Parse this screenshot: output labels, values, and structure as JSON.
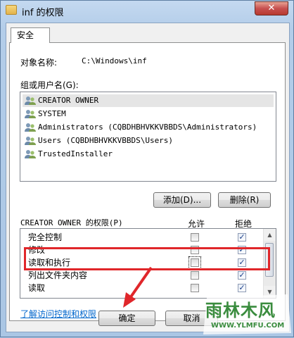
{
  "window": {
    "title": "inf 的权限",
    "close_label": "✕"
  },
  "tab": {
    "label": "安全"
  },
  "object": {
    "label": "对象名称:",
    "value": "C:\\Windows\\inf"
  },
  "groups": {
    "label": "组或用户名(G):",
    "items": [
      {
        "name": "CREATOR OWNER",
        "selected": true
      },
      {
        "name": "SYSTEM",
        "selected": false
      },
      {
        "name": "Administrators (CQBDHBHVKKVBBDS\\Administrators)",
        "selected": false
      },
      {
        "name": "Users (CQBDHBHVKKVBBDS\\Users)",
        "selected": false
      },
      {
        "name": "TrustedInstaller",
        "selected": false
      }
    ]
  },
  "buttons": {
    "add": "添加(D)...",
    "remove": "删除(R)",
    "ok": "确定",
    "cancel": "取消"
  },
  "permissions": {
    "title": "CREATOR OWNER 的权限(P)",
    "allow_header": "允许",
    "deny_header": "拒绝",
    "rows": [
      {
        "name": "完全控制",
        "allow": false,
        "deny": true
      },
      {
        "name": "修改",
        "allow": false,
        "deny": true
      },
      {
        "name": "读取和执行",
        "allow": false,
        "deny": true
      },
      {
        "name": "列出文件夹内容",
        "allow": false,
        "deny": true
      },
      {
        "name": "读取",
        "allow": false,
        "deny": true
      }
    ]
  },
  "link": {
    "text": "了解访问控制和权限"
  },
  "watermark": {
    "main": "雨林木风",
    "url": "WWW.YLMFU.COM"
  },
  "colors": {
    "highlight": "#e0262a",
    "arrow": "#e0262a",
    "link": "#0066cc"
  }
}
